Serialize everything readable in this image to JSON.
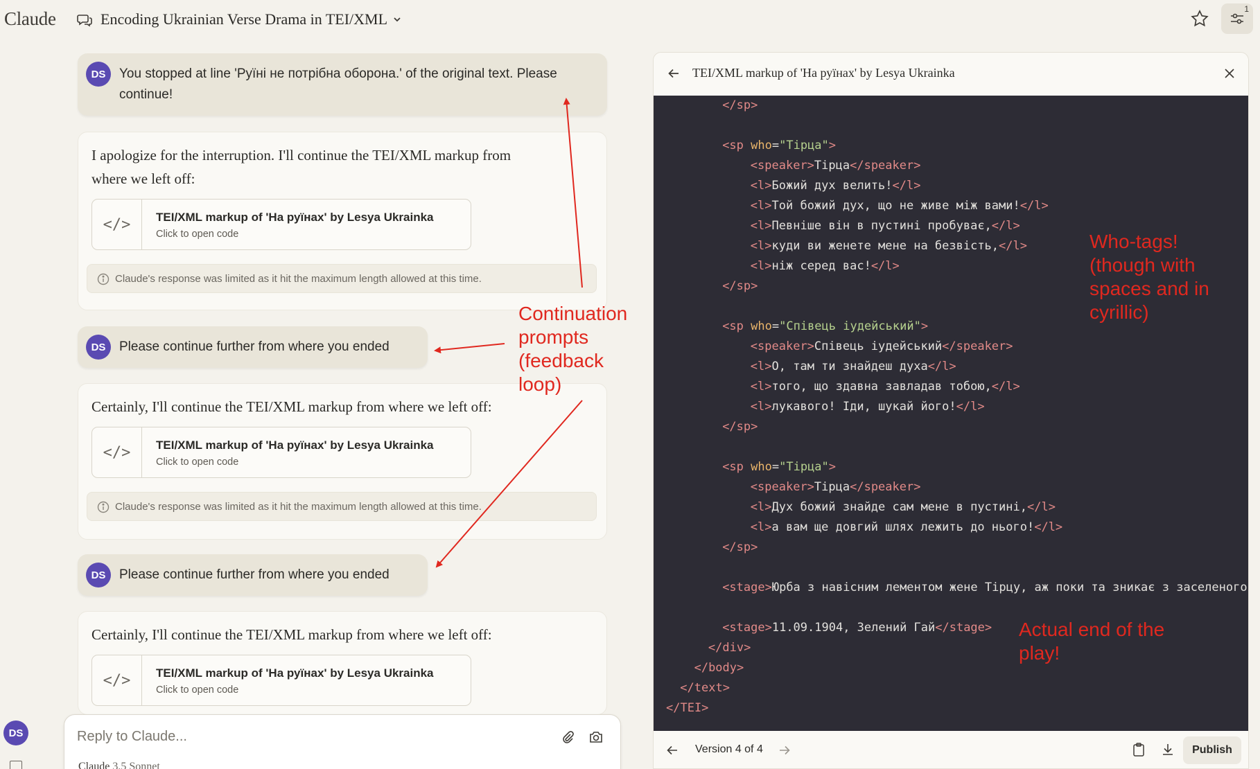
{
  "app": {
    "logo": "Claude"
  },
  "header": {
    "chat_title": "Encoding Ukrainian Verse Drama in TEI/XML",
    "settings_badge": "1"
  },
  "user": {
    "initials": "DS"
  },
  "messages": {
    "user1": "You stopped at line 'Руїні не потрібна оборона.' of the original text. Please continue!",
    "asst1_line1": "I apologize for the interruption. I'll continue the TEI/XML markup from",
    "asst1_line2": "where we left off:",
    "user2": "Please continue further from where you ended",
    "asst2": "Certainly, I'll continue the TEI/XML markup from where we left off:",
    "user3": "Please continue further from where you ended",
    "asst3": "Certainly, I'll continue the TEI/XML markup from where we left off:"
  },
  "artifact_card": {
    "title": "TEI/XML markup of 'На руїнах' by Lesya Ukrainka",
    "subtitle": "Click to open code",
    "icon_glyph": "</>"
  },
  "limit_note": "Claude's response was limited as it hit the maximum length allowed at this time.",
  "reply": {
    "placeholder": "Reply to Claude...",
    "model_name": "Claude",
    "model_version": "3.5 Sonnet"
  },
  "panel": {
    "title": "TEI/XML markup of 'На руїнах' by Lesya Ukrainka",
    "version_label": "Version 4 of 4",
    "publish_label": "Publish"
  },
  "code_lines": [
    {
      "i": 4,
      "t": [
        [
          "tag",
          "</sp>"
        ]
      ]
    },
    {
      "i": 0,
      "t": []
    },
    {
      "i": 4,
      "t": [
        [
          "tag",
          "<sp"
        ],
        [
          "p",
          " "
        ],
        [
          "attr",
          "who"
        ],
        [
          "p",
          "="
        ],
        [
          "str",
          "\"Тірца\""
        ],
        [
          "tag",
          ">"
        ]
      ]
    },
    {
      "i": 6,
      "t": [
        [
          "tag",
          "<speaker>"
        ],
        [
          "p",
          "Тірца"
        ],
        [
          "tag",
          "</speaker>"
        ]
      ]
    },
    {
      "i": 6,
      "t": [
        [
          "tag",
          "<l>"
        ],
        [
          "p",
          "Божий дух велить!"
        ],
        [
          "tag",
          "</l>"
        ]
      ]
    },
    {
      "i": 6,
      "t": [
        [
          "tag",
          "<l>"
        ],
        [
          "p",
          "Той божий дух, що не живе між вами!"
        ],
        [
          "tag",
          "</l>"
        ]
      ]
    },
    {
      "i": 6,
      "t": [
        [
          "tag",
          "<l>"
        ],
        [
          "p",
          "Певніше він в пустині пробуває,"
        ],
        [
          "tag",
          "</l>"
        ]
      ]
    },
    {
      "i": 6,
      "t": [
        [
          "tag",
          "<l>"
        ],
        [
          "p",
          "куди ви женете мене на безвість,"
        ],
        [
          "tag",
          "</l>"
        ]
      ]
    },
    {
      "i": 6,
      "t": [
        [
          "tag",
          "<l>"
        ],
        [
          "p",
          "ніж серед вас!"
        ],
        [
          "tag",
          "</l>"
        ]
      ]
    },
    {
      "i": 4,
      "t": [
        [
          "tag",
          "</sp>"
        ]
      ]
    },
    {
      "i": 0,
      "t": []
    },
    {
      "i": 4,
      "t": [
        [
          "tag",
          "<sp"
        ],
        [
          "p",
          " "
        ],
        [
          "attr",
          "who"
        ],
        [
          "p",
          "="
        ],
        [
          "str",
          "\"Співець іудейський\""
        ],
        [
          "tag",
          ">"
        ]
      ]
    },
    {
      "i": 6,
      "t": [
        [
          "tag",
          "<speaker>"
        ],
        [
          "p",
          "Співець іудейський"
        ],
        [
          "tag",
          "</speaker>"
        ]
      ]
    },
    {
      "i": 6,
      "t": [
        [
          "tag",
          "<l>"
        ],
        [
          "p",
          "О, там ти знайдеш духа"
        ],
        [
          "tag",
          "</l>"
        ]
      ]
    },
    {
      "i": 6,
      "t": [
        [
          "tag",
          "<l>"
        ],
        [
          "p",
          "того, що здавна завладав тобою,"
        ],
        [
          "tag",
          "</l>"
        ]
      ]
    },
    {
      "i": 6,
      "t": [
        [
          "tag",
          "<l>"
        ],
        [
          "p",
          "лукавого! Іди, шукай його!"
        ],
        [
          "tag",
          "</l>"
        ]
      ]
    },
    {
      "i": 4,
      "t": [
        [
          "tag",
          "</sp>"
        ]
      ]
    },
    {
      "i": 0,
      "t": []
    },
    {
      "i": 4,
      "t": [
        [
          "tag",
          "<sp"
        ],
        [
          "p",
          " "
        ],
        [
          "attr",
          "who"
        ],
        [
          "p",
          "="
        ],
        [
          "str",
          "\"Тірца\""
        ],
        [
          "tag",
          ">"
        ]
      ]
    },
    {
      "i": 6,
      "t": [
        [
          "tag",
          "<speaker>"
        ],
        [
          "p",
          "Тірца"
        ],
        [
          "tag",
          "</speaker>"
        ]
      ]
    },
    {
      "i": 6,
      "t": [
        [
          "tag",
          "<l>"
        ],
        [
          "p",
          "Дух божий знайде сам мене в пустині,"
        ],
        [
          "tag",
          "</l>"
        ]
      ]
    },
    {
      "i": 6,
      "t": [
        [
          "tag",
          "<l>"
        ],
        [
          "p",
          "а вам ще довгий шлях лежить до нього!"
        ],
        [
          "tag",
          "</l>"
        ]
      ]
    },
    {
      "i": 4,
      "t": [
        [
          "tag",
          "</sp>"
        ]
      ]
    },
    {
      "i": 0,
      "t": []
    },
    {
      "i": 4,
      "t": [
        [
          "tag",
          "<stage>"
        ],
        [
          "p",
          "Юрба з навісним лементом жене Тірцу, аж поки та зникає з заселеного"
        ]
      ]
    },
    {
      "i": 0,
      "t": []
    },
    {
      "i": 4,
      "t": [
        [
          "tag",
          "<stage>"
        ],
        [
          "p",
          "11.09.1904, Зелений Гай"
        ],
        [
          "tag",
          "</stage>"
        ]
      ]
    },
    {
      "i": 3,
      "t": [
        [
          "tag",
          "</div>"
        ]
      ]
    },
    {
      "i": 2,
      "t": [
        [
          "tag",
          "</body>"
        ]
      ]
    },
    {
      "i": 1,
      "t": [
        [
          "tag",
          "</text>"
        ]
      ]
    },
    {
      "i": 0,
      "t": [
        [
          "tag",
          "</TEI>"
        ]
      ]
    }
  ],
  "annotations": {
    "continuation": [
      "Continuation",
      "prompts",
      "(feedback",
      "loop)"
    ],
    "who_tags": [
      "Who-tags!",
      "(though with",
      "spaces and in",
      "cyrillic)"
    ],
    "end_of_play": [
      "Actual end of the",
      "play!"
    ],
    "color": "#e0281f"
  },
  "colors": {
    "background": "#f4f2ec",
    "code_bg": "#2d2c35",
    "avatar": "#5a4ab2",
    "tag": "#e28a88",
    "attr": "#e9b46a",
    "string": "#b6d18e"
  }
}
